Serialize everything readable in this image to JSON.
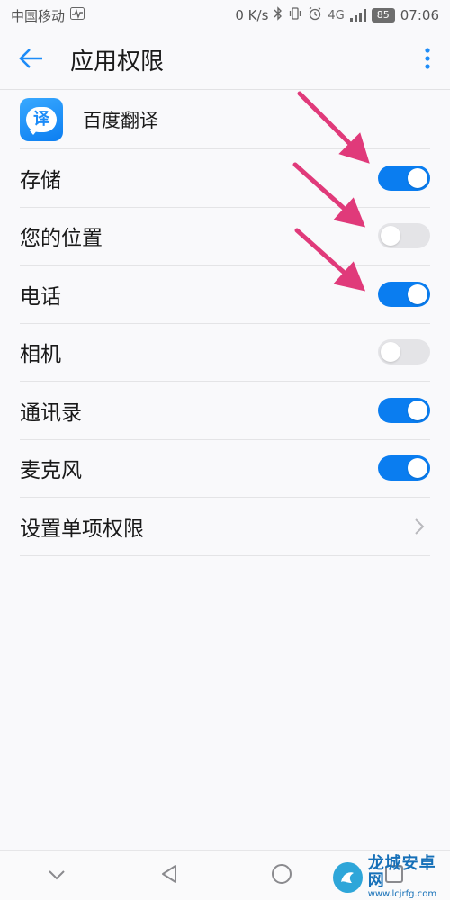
{
  "status_bar": {
    "carrier": "中国移动",
    "net_speed": "0 K/s",
    "network_type": "4G",
    "battery": "85",
    "time": "07:06"
  },
  "header": {
    "title": "应用权限",
    "back_icon": "back-arrow-icon",
    "more_icon": "more-vert-icon",
    "accent": "#1d8cf8"
  },
  "app": {
    "name": "百度翻译",
    "icon_glyph": "译"
  },
  "permissions": [
    {
      "label": "存储",
      "enabled": true
    },
    {
      "label": "您的位置",
      "enabled": false
    },
    {
      "label": "电话",
      "enabled": true
    },
    {
      "label": "相机",
      "enabled": false
    },
    {
      "label": "通讯录",
      "enabled": true
    },
    {
      "label": "麦克风",
      "enabled": true
    }
  ],
  "single_permission": {
    "label": "设置单项权限"
  },
  "nav": {
    "icons": [
      "chevron-down-icon",
      "back-triangle-icon",
      "home-circle-icon",
      "recents-square-icon"
    ]
  },
  "watermark": {
    "title": "龙城安卓网",
    "url": "www.lcjrfg.com"
  },
  "colors": {
    "toggle_on": "#0a7df0",
    "toggle_off": "#e4e4e7",
    "annotation_arrow": "#e03a7a"
  }
}
